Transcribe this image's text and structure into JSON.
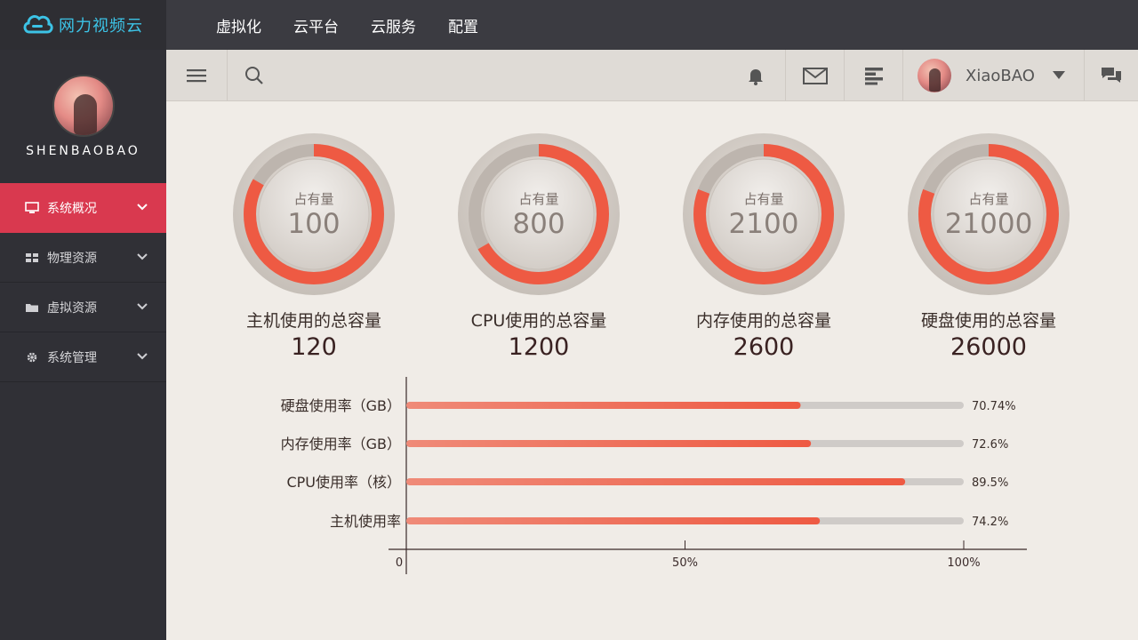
{
  "brand": {
    "name": "网力视频云"
  },
  "topnav": [
    "虚拟化",
    "云平台",
    "云服务",
    "配置"
  ],
  "sidebar": {
    "profile_name": "SHENBAOBAO",
    "items": [
      {
        "label": "系统概况",
        "icon": "monitor-icon",
        "active": true
      },
      {
        "label": "物理资源",
        "icon": "grid-icon",
        "active": false
      },
      {
        "label": "虚拟资源",
        "icon": "folder-icon",
        "active": false
      },
      {
        "label": "系统管理",
        "icon": "gear-icon",
        "active": false
      }
    ]
  },
  "toolbar": {
    "user_name": "XiaoBAO"
  },
  "gauges": [
    {
      "label": "占有量",
      "value": "100",
      "title": "主机使用的总容量",
      "total": "120",
      "fraction": 0.8333
    },
    {
      "label": "占有量",
      "value": "800",
      "title": "CPU使用的总容量",
      "total": "1200",
      "fraction": 0.6667
    },
    {
      "label": "占有量",
      "value": "2100",
      "title": "内存使用的总容量",
      "total": "2600",
      "fraction": 0.8077
    },
    {
      "label": "占有量",
      "value": "21000",
      "title": "硬盘使用的总容量",
      "total": "26000",
      "fraction": 0.8077
    }
  ],
  "colors": {
    "accent": "#d9394f",
    "bar": "#ee5a43",
    "brand": "#3cc3e6"
  },
  "chart_data": {
    "type": "bar",
    "orientation": "horizontal",
    "categories": [
      "硬盘使用率（GB）",
      "内存使用率（GB）",
      "CPU使用率（核）",
      "主机使用率"
    ],
    "values": [
      70.74,
      72.6,
      89.5,
      74.2
    ],
    "value_labels": [
      "70.74%",
      "72.6%",
      "89.5%",
      "74.2%"
    ],
    "xlim": [
      0,
      100
    ],
    "xticks": [
      "0",
      "50%",
      "100%"
    ]
  }
}
